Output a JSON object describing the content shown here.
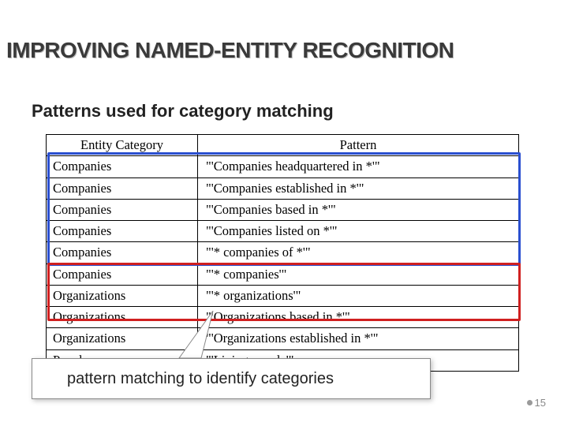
{
  "title": "IMPROVING NAMED-ENTITY RECOGNITION",
  "subtitle": "Patterns used for category matching",
  "table": {
    "headers": [
      "Entity Category",
      "Pattern"
    ],
    "rows": [
      {
        "cat": "Companies",
        "pat": "\"'Companies headquartered in *'\""
      },
      {
        "cat": "Companies",
        "pat": "\"'Companies established in *'\""
      },
      {
        "cat": "Companies",
        "pat": "\"'Companies based in *'\""
      },
      {
        "cat": "Companies",
        "pat": "\"'Companies listed on *'\""
      },
      {
        "cat": "Companies",
        "pat": "\"'* companies of *'\""
      },
      {
        "cat": "Companies",
        "pat": "\"'* companies'\""
      },
      {
        "cat": "Organizations",
        "pat": "\"'* organizations'\""
      },
      {
        "cat": "Organizations",
        "pat": "\"'Organizations based in *'\""
      },
      {
        "cat": "Organizations",
        "pat": "\"'Organizations established in *'\""
      },
      {
        "cat": "People",
        "pat": "\"'Living people'\""
      }
    ]
  },
  "callout": "pattern matching to identify categories",
  "page_number": "15"
}
